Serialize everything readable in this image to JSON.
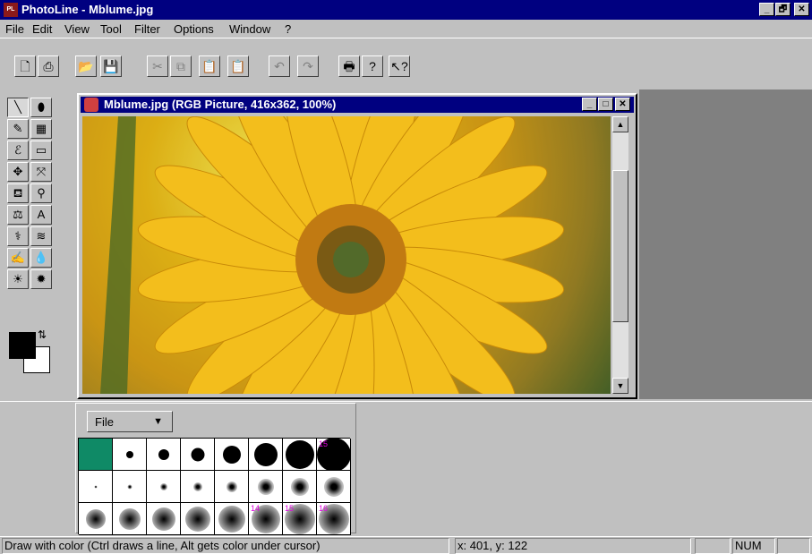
{
  "app": {
    "title": "PhotoLine - Mblume.jpg",
    "icon": "photoline-app-icon",
    "icon_text": "PL",
    "caption_minimize": "_",
    "caption_restore": "🗗",
    "caption_close": "✕"
  },
  "menu": {
    "items": [
      {
        "label": "File"
      },
      {
        "label": "Edit"
      },
      {
        "label": "View"
      },
      {
        "label": "Tool"
      },
      {
        "label": "Filter"
      },
      {
        "label": "Options"
      },
      {
        "label": "Window"
      },
      {
        "label": "?"
      }
    ]
  },
  "toolbar": {
    "buttons": [
      {
        "name": "new-document-icon",
        "glyph": "🗋"
      },
      {
        "name": "scan-icon",
        "glyph": "⎙"
      },
      {
        "name": "open-folder-icon",
        "glyph": "📂"
      },
      {
        "name": "save-disk-icon",
        "glyph": "💾"
      },
      {
        "name": "cut-scissors-icon",
        "glyph": "✂"
      },
      {
        "name": "copy-icon",
        "glyph": "⧉"
      },
      {
        "name": "paste-icon",
        "glyph": "📋"
      },
      {
        "name": "paste-special-icon",
        "glyph": "📋"
      },
      {
        "name": "undo-icon",
        "glyph": "↶"
      },
      {
        "name": "redo-icon",
        "glyph": "↷"
      },
      {
        "name": "print-icon",
        "glyph": "🖶"
      },
      {
        "name": "help-icon",
        "glyph": "?"
      },
      {
        "name": "context-help-icon",
        "glyph": "↖?"
      }
    ]
  },
  "tools": {
    "items": [
      {
        "name": "brush-tool-icon",
        "glyph": "╲"
      },
      {
        "name": "eraser-tool-icon",
        "glyph": "⬮"
      },
      {
        "name": "pen-tool-icon",
        "glyph": "✎"
      },
      {
        "name": "gradient-tool-icon",
        "glyph": "▦"
      },
      {
        "name": "lasso-tool-icon",
        "glyph": "ℰ"
      },
      {
        "name": "rectangle-select-icon",
        "glyph": "▭"
      },
      {
        "name": "move-tool-icon",
        "glyph": "✥"
      },
      {
        "name": "transform-tool-icon",
        "glyph": "⤧"
      },
      {
        "name": "fill-bucket-icon",
        "glyph": "⛾"
      },
      {
        "name": "zoom-tool-icon",
        "glyph": "⚲"
      },
      {
        "name": "stamp-tool-icon",
        "glyph": "⚖"
      },
      {
        "name": "text-tool-icon",
        "glyph": "A"
      },
      {
        "name": "smudge-tool-icon",
        "glyph": "⚕"
      },
      {
        "name": "blur-tool-icon",
        "glyph": "≋"
      },
      {
        "name": "sharpen-tool-icon",
        "glyph": "✍"
      },
      {
        "name": "water-drop-tool-icon",
        "glyph": "💧"
      },
      {
        "name": "lighten-tool-icon",
        "glyph": "☀"
      },
      {
        "name": "darken-tool-icon",
        "glyph": "✹"
      }
    ],
    "swap_glyph": "⇅"
  },
  "colors": {
    "foreground": "#000000",
    "background": "#ffffff",
    "title_bar": "#000080",
    "selected_brush": "#0f8a66",
    "brush_number": "#e000e0"
  },
  "document": {
    "title": "Mblume.jpg (RGB Picture, 416x362, 100%)",
    "minimize": "_",
    "maximize": "□",
    "close": "✕",
    "scroll_up": "▲",
    "scroll_down": "▼"
  },
  "brushes": {
    "dropdown_label": "File",
    "dropdown_arrow": "▼",
    "hard_sizes": [
      0,
      8,
      12,
      15,
      20,
      26,
      32,
      38
    ],
    "soft_sizes": [
      3,
      5,
      8,
      10,
      12,
      18,
      20,
      22
    ],
    "blur_sizes": [
      22,
      24,
      26,
      28,
      30,
      32,
      34,
      34
    ],
    "labels": {
      "hard_7": "15",
      "blur_5": "14",
      "blur_6": "15",
      "blur_7": "16"
    }
  },
  "status": {
    "hint": "Draw with color (Ctrl draws a line, Alt gets color under cursor)",
    "coords": "x: 401, y: 122",
    "num": "NUM"
  }
}
